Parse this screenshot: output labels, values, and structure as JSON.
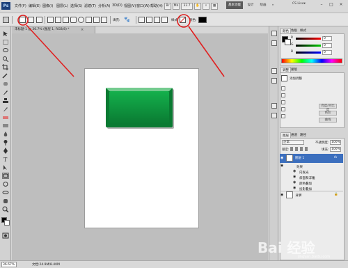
{
  "menubar": {
    "logo": "Ps",
    "items": [
      "文件(F)",
      "编辑(E)",
      "图像(I)",
      "图层(L)",
      "选择(S)",
      "滤镜(T)",
      "分析(A)",
      "3D(D)",
      "视图(V)",
      "窗口(W)",
      "帮助(H)"
    ],
    "zoom": "33.7",
    "workspaces": [
      "基本功能",
      "设计",
      "绘画"
    ],
    "more": "»",
    "cs_live": "CS Live▾",
    "window_buttons": [
      "–",
      "□",
      "×"
    ]
  },
  "options": {
    "mode_label": "填充:",
    "style_label": "样式:",
    "color_label": "颜色:",
    "color": "#000000",
    "annotation_color": "#e02020"
  },
  "document": {
    "tab_title": "未标题-1 @ 36.7% (图层 1, RGB/8) *",
    "tab_close": "×",
    "status_zoom": "36.67%",
    "status_doc": "文档:24.9M/8.40M",
    "shape_colors": [
      "#0a7a32",
      "#14b04c",
      "#8fe0a6"
    ]
  },
  "color_panel": {
    "tabs": [
      "颜色",
      "色板",
      "样式"
    ],
    "sliders": [
      {
        "label": "R",
        "value": "0"
      },
      {
        "label": "G",
        "value": "0"
      },
      {
        "label": "B",
        "value": "0"
      }
    ]
  },
  "adjust_panel": {
    "tabs": [
      "调整",
      "蒙版"
    ],
    "header": "添加调整",
    "buttons": [
      "亮度/对比度",
      "色阶",
      "曲线"
    ]
  },
  "layers_panel": {
    "tabs": [
      "图层",
      "通道",
      "路径"
    ],
    "blend_mode": "正常",
    "opacity_label": "不透明度:",
    "opacity": "100%",
    "lock_label": "锁定:",
    "fill_label": "填充:",
    "fill": "100%",
    "layers": [
      {
        "name": "图层 1",
        "fx": "fx"
      },
      {
        "name": "背景",
        "lock": "🔒"
      }
    ],
    "effects_label": "效果",
    "effects": [
      "内发光",
      "斜面和浮雕",
      "颜色叠加",
      "投影叠加"
    ]
  },
  "watermark": {
    "text": "Bai 经验",
    "sub": "jingyan.baidu.com"
  }
}
